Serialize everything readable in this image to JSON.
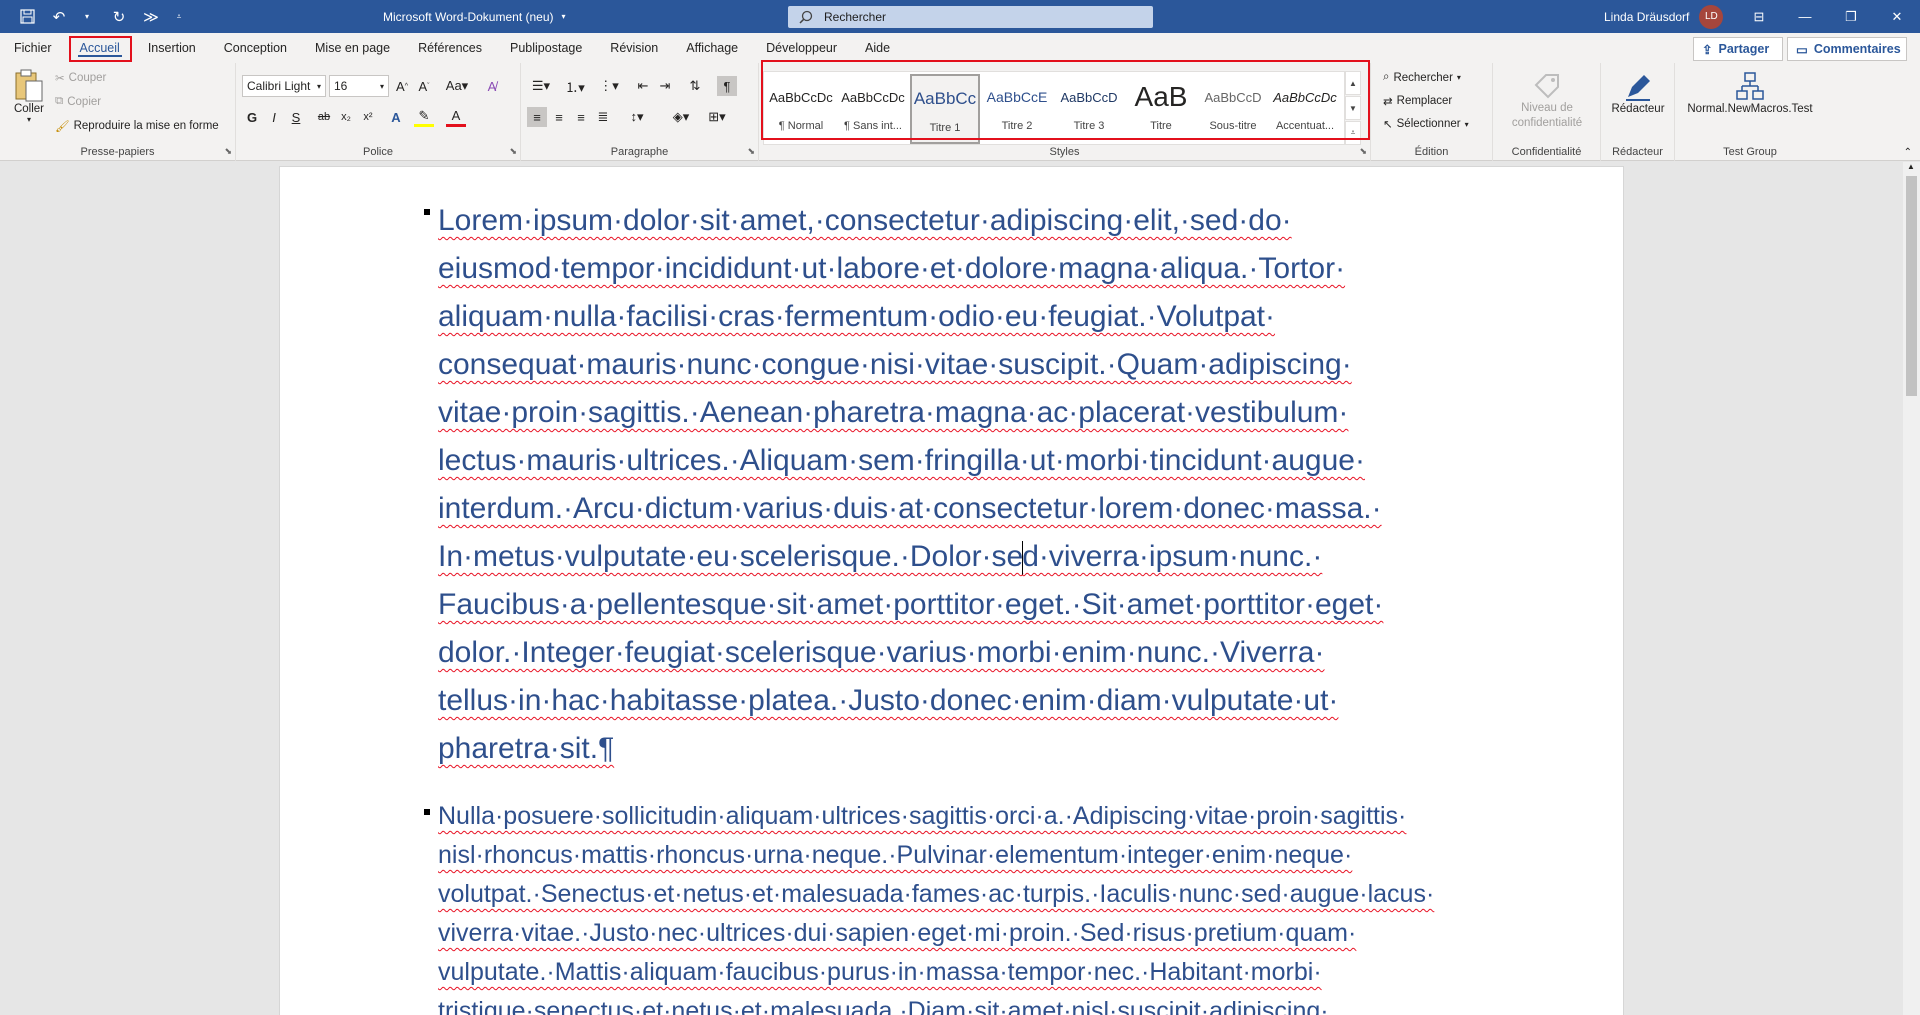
{
  "title_bar": {
    "doc_title": "Microsoft Word-Dokument (neu)",
    "search_placeholder": "Rechercher",
    "user_name": "Linda Dräusdorf",
    "user_initials": "LD"
  },
  "menu": {
    "tabs": [
      "Fichier",
      "Accueil",
      "Insertion",
      "Conception",
      "Mise en page",
      "Références",
      "Publipostage",
      "Révision",
      "Affichage",
      "Développeur",
      "Aide"
    ],
    "active": "Accueil",
    "share": "Partager",
    "comments": "Commentaires"
  },
  "clipboard": {
    "label": "Presse-papiers",
    "paste": "Coller",
    "cut": "Couper",
    "copy": "Copier",
    "format_painter": "Reproduire la mise en forme"
  },
  "font": {
    "label": "Police",
    "name": "Calibri Light",
    "size": "16"
  },
  "paragraph": {
    "label": "Paragraphe"
  },
  "styles": {
    "label": "Styles",
    "items": [
      {
        "preview": "AaBbCcDc",
        "name": "¶ Normal"
      },
      {
        "preview": "AaBbCcDc",
        "name": "¶ Sans int..."
      },
      {
        "preview": "AaBbCc",
        "name": "Titre 1"
      },
      {
        "preview": "AaBbCcE",
        "name": "Titre 2"
      },
      {
        "preview": "AaBbCcD",
        "name": "Titre 3"
      },
      {
        "preview": "AaB",
        "name": "Titre"
      },
      {
        "preview": "AaBbCcD",
        "name": "Sous-titre"
      },
      {
        "preview": "AaBbCcDc",
        "name": "Accentuat..."
      }
    ],
    "selected_index": 2
  },
  "editing": {
    "label": "Édition",
    "find": "Rechercher",
    "replace": "Remplacer",
    "select": "Sélectionner"
  },
  "sensitivity": {
    "label": "Confidentialité",
    "button": "Niveau de confidentialité"
  },
  "editor": {
    "label": "Rédacteur",
    "button": "Rédacteur"
  },
  "test_group": {
    "label": "Test Group",
    "button": "Normal.NewMacros.Test"
  },
  "document": {
    "para1_a": "Lorem·ipsum·dolor·sit·amet,·consectetur·adipiscing·elit,·sed·do· eiusmod·tempor·incididunt·ut·labore·et·dolore·magna·aliqua.·Tortor· aliquam·nulla·facilisi·cras·fermentum·odio·eu·feugiat.·Volutpat· consequat·mauris·nunc·congue·nisi·vitae·suscipit.·Quam·adipiscing· vitae·proin·sagittis.·Aenean·pharetra·magna·ac·placerat·vestibulum· lectus·mauris·ultrices.·Aliquam·sem·fringilla·ut·morbi·tincidunt·augue· interdum.·Arcu·dictum·varius·duis·at·consectetur·lorem·donec·massa.· In·metus·vulputate·eu·scelerisque.·Dolor·se",
    "para1_b": "d·viverra·ipsum·nunc.· Faucibus·a·pellentesque·sit·amet·porttitor·eget.·Sit·amet·porttitor·eget· dolor.·Integer·feugiat·scelerisque·varius·morbi·enim·nunc.·Viverra· tellus·in·hac·habitasse·platea.·Justo·donec·enim·diam·vulputate·ut· pharetra·sit.¶",
    "para2": "Nulla·posuere·sollicitudin·aliquam·ultrices·sagittis·orci·a.·Adipiscing·vitae·proin·sagittis· nisl·rhoncus·mattis·rhoncus·urna·neque.·Pulvinar·elementum·integer·enim·neque· volutpat.·Senectus·et·netus·et·malesuada·fames·ac·turpis.·Iaculis·nunc·sed·augue·lacus· viverra·vitae.·Justo·nec·ultrices·dui·sapien·eget·mi·proin.·Sed·risus·pretium·quam· vulputate.·Mattis·aliquam·faucibus·purus·in·massa·tempor·nec.·Habitant·morbi· tristique·senectus·et·netus·et·malesuada.·Diam·sit·amet·nisl·suscipit·adipiscing·"
  },
  "colors": {
    "brand": "#2b579a",
    "heading_text": "#2e4f8c",
    "highlight_box": "#e3101c"
  }
}
